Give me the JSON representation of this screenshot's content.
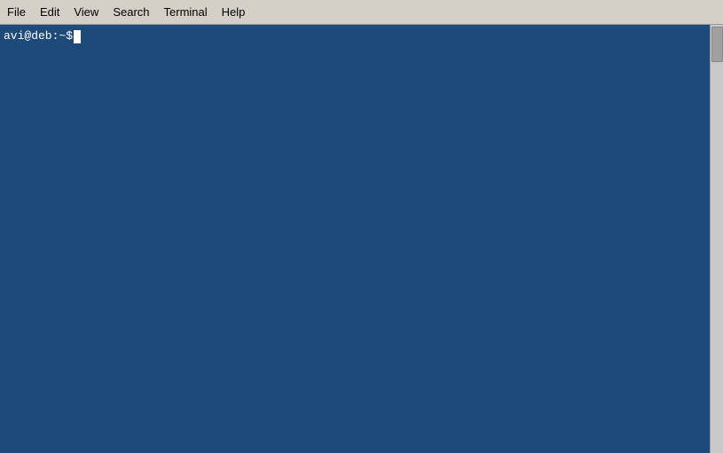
{
  "menubar": {
    "items": [
      {
        "id": "file",
        "label": "File"
      },
      {
        "id": "edit",
        "label": "Edit"
      },
      {
        "id": "view",
        "label": "View"
      },
      {
        "id": "search",
        "label": "Search"
      },
      {
        "id": "terminal",
        "label": "Terminal"
      },
      {
        "id": "help",
        "label": "Help"
      }
    ]
  },
  "terminal": {
    "prompt": "avi@deb:~$ ",
    "background_color": "#1e4a7a"
  }
}
